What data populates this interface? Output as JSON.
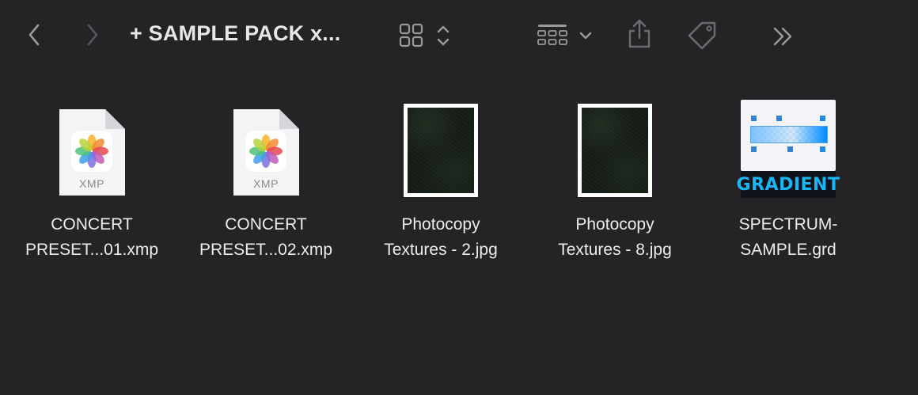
{
  "toolbar": {
    "title": "+ SAMPLE PACK x...",
    "back_icon": "chevron-left-icon",
    "forward_icon": "chevron-right-icon",
    "view_icon": "grid-view-icon",
    "group_icon": "group-by-icon",
    "share_icon": "share-icon",
    "tag_icon": "tag-icon",
    "more_icon": "double-chevron-right-icon"
  },
  "files": [
    {
      "name": "CONCERT\nPRESET...01.xmp",
      "kind": "xmp",
      "ext": "XMP"
    },
    {
      "name": "CONCERT\nPRESET...02.xmp",
      "kind": "xmp",
      "ext": "XMP"
    },
    {
      "name": "Photocopy\nTextures - 2.jpg",
      "kind": "jpg"
    },
    {
      "name": "Photocopy\nTextures - 8.jpg",
      "kind": "jpg"
    },
    {
      "name": "SPECTRUM-\nSAMPLE.grd",
      "kind": "grd",
      "badge": "GRADIENT"
    }
  ],
  "colors": {
    "background": "#262326",
    "text": "#ececec",
    "icon": "#8e8c8f",
    "gradient_badge": "#18b6f5"
  }
}
